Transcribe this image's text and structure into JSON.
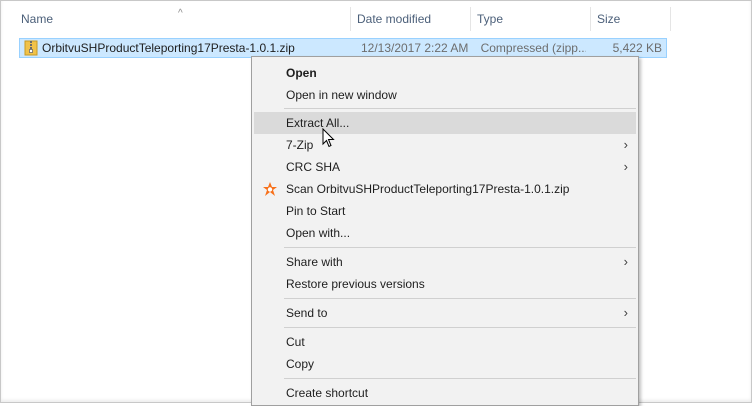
{
  "columns": {
    "name": "Name",
    "date": "Date modified",
    "type": "Type",
    "size": "Size",
    "sort_indicator": "^"
  },
  "file": {
    "name": "OrbitvuSHProductTeleporting17Presta-1.0.1.zip",
    "date": "12/13/2017 2:22 AM",
    "type": "Compressed (zipp...",
    "size": "5,422 KB",
    "icon": "zip-folder-icon"
  },
  "menu": {
    "open": "Open",
    "open_new_window": "Open in new window",
    "extract_all": "Extract All...",
    "seven_zip": "7-Zip",
    "crc_sha": "CRC SHA",
    "scan": "Scan OrbitvuSHProductTeleporting17Presta-1.0.1.zip",
    "pin_to_start": "Pin to Start",
    "open_with": "Open with...",
    "share_with": "Share with",
    "restore_previous": "Restore previous versions",
    "send_to": "Send to",
    "cut": "Cut",
    "copy": "Copy",
    "create_shortcut": "Create shortcut",
    "submenu_glyph": "›",
    "scan_icon": "avast-icon",
    "hover_color": "#dadada"
  },
  "colors": {
    "selection_bg": "#cce8ff",
    "selection_border": "#99d1ff",
    "menu_bg": "#f2f2f2",
    "header_text": "#4c607a",
    "avast_orange": "#f7701a"
  }
}
